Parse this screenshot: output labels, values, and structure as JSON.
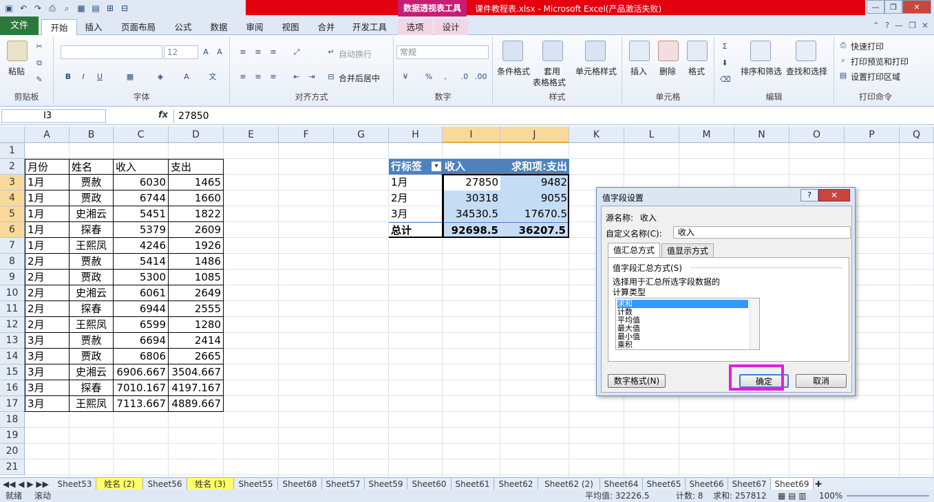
{
  "qat": {
    "icons": [
      "save-icon",
      "undo-icon",
      "redo-icon",
      "print-icon",
      "preview-icon",
      "grid-icon",
      "format-icon",
      "insert-icon",
      "table-icon"
    ]
  },
  "titlebar": {
    "context_tool": "数据透视表工具",
    "title": "课件教程表.xlsx - Microsoft Excel(产品激活失败)"
  },
  "tabs": {
    "file": "文件",
    "items": [
      "开始",
      "插入",
      "页面布局",
      "公式",
      "数据",
      "审阅",
      "视图",
      "合并",
      "开发工具",
      "选项",
      "设计"
    ]
  },
  "ribbon": {
    "clipboard": {
      "paste": "粘贴",
      "group": "剪贴板"
    },
    "font": {
      "size": "12",
      "group": "字体"
    },
    "align": {
      "wrap": "自动换行",
      "merge": "合并后居中",
      "group": "对齐方式"
    },
    "number": {
      "format": "常规",
      "group": "数字"
    },
    "styles": {
      "cond": "条件格式",
      "table1": "套用",
      "table2": "表格格式",
      "cell": "单元格样式",
      "group": "样式"
    },
    "cells": {
      "insert": "插入",
      "delete": "删除",
      "format": "格式",
      "group": "单元格"
    },
    "edit": {
      "sort": "排序和筛选",
      "find": "查找和选择",
      "group": "编辑"
    },
    "print": {
      "quick": "快速打印",
      "preview": "打印预览和打印",
      "area": "设置打印区域",
      "group": "打印命令"
    }
  },
  "formula_bar": {
    "name": "I3",
    "fx": "fx",
    "value": "27850"
  },
  "columns": [
    "A",
    "B",
    "C",
    "D",
    "E",
    "F",
    "G",
    "H",
    "I",
    "J",
    "K",
    "L",
    "M",
    "N",
    "O",
    "P",
    "Q"
  ],
  "rows": [
    "1",
    "2",
    "3",
    "4",
    "5",
    "6",
    "7",
    "8",
    "9",
    "10",
    "11",
    "12",
    "13",
    "14",
    "15",
    "16",
    "17",
    "18",
    "19",
    "20",
    "21"
  ],
  "table": {
    "headers": [
      "月份",
      "姓名",
      "收入",
      "支出"
    ],
    "rows": [
      [
        "1月",
        "贾赦",
        "6030",
        "1465"
      ],
      [
        "1月",
        "贾政",
        "6744",
        "1660"
      ],
      [
        "1月",
        "史湘云",
        "5451",
        "1822"
      ],
      [
        "1月",
        "探春",
        "5379",
        "2609"
      ],
      [
        "1月",
        "王熙凤",
        "4246",
        "1926"
      ],
      [
        "2月",
        "贾赦",
        "5414",
        "1486"
      ],
      [
        "2月",
        "贾政",
        "5300",
        "1085"
      ],
      [
        "2月",
        "史湘云",
        "6061",
        "2649"
      ],
      [
        "2月",
        "探春",
        "6944",
        "2555"
      ],
      [
        "2月",
        "王熙凤",
        "6599",
        "1280"
      ],
      [
        "3月",
        "贾赦",
        "6694",
        "2414"
      ],
      [
        "3月",
        "贾政",
        "6806",
        "2665"
      ],
      [
        "3月",
        "史湘云",
        "6906.667",
        "3504.667"
      ],
      [
        "3月",
        "探春",
        "7010.167",
        "4197.167"
      ],
      [
        "3月",
        "王熙凤",
        "7113.667",
        "4889.667"
      ]
    ]
  },
  "pivot": {
    "headers": [
      "行标签",
      "收入",
      "求和项:支出"
    ],
    "rows": [
      [
        "1月",
        "27850",
        "9482"
      ],
      [
        "2月",
        "30318",
        "9055"
      ],
      [
        "3月",
        "34530.5",
        "17670.5"
      ]
    ],
    "total": [
      "总计",
      "92698.5",
      "36207.5"
    ]
  },
  "dialog": {
    "title": "值字段设置",
    "close": "✕",
    "help": "?",
    "source_label": "源名称:",
    "source_value": "收入",
    "custom_label": "自定义名称(C):",
    "custom_value": "收入",
    "tab1": "值汇总方式",
    "tab2": "值显示方式",
    "section": "值字段汇总方式(S)",
    "desc1": "选择用于汇总所选字段数据的",
    "desc2": "计算类型",
    "list": [
      "求和",
      "计数",
      "平均值",
      "最大值",
      "最小值",
      "乘积"
    ],
    "number_format": "数字格式(N)",
    "ok": "确定",
    "cancel": "取消"
  },
  "sheets": [
    "Sheet53",
    "姓名 (2)",
    "Sheet56",
    "姓名 (3)",
    "Sheet55",
    "Sheet68",
    "Sheet57",
    "Sheet59",
    "Sheet60",
    "Sheet61",
    "Sheet62",
    "Sheet62 (2)",
    "Sheet64",
    "Sheet65",
    "Sheet66",
    "Sheet67",
    "Sheet69"
  ],
  "status": {
    "ready": "就绪",
    "scroll": "滚动",
    "avg": "平均值: 32226.5",
    "count": "计数: 8",
    "sum": "求和: 257812",
    "zoom": "100%"
  }
}
